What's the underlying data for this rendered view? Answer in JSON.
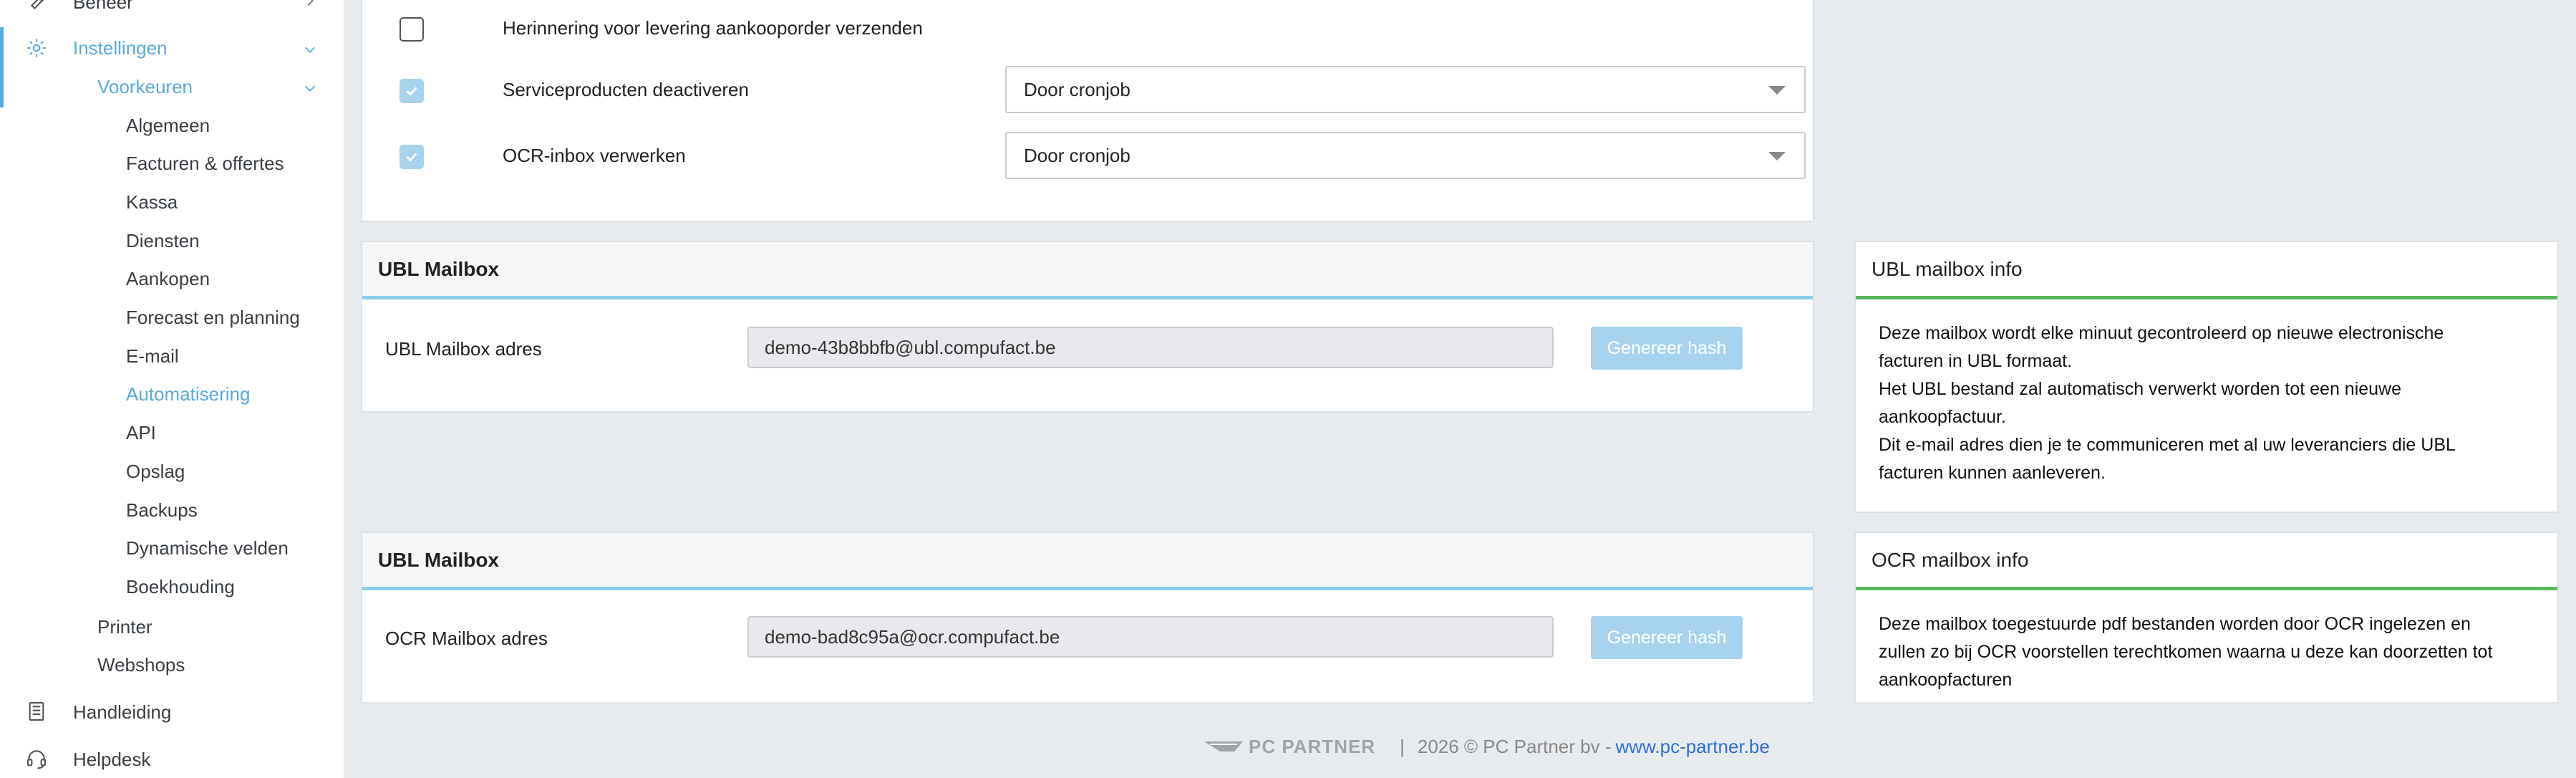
{
  "sidebar": {
    "beheer": "Beheer",
    "instellingen": "Instellingen",
    "voorkeuren": "Voorkeuren",
    "sub_items": [
      {
        "label": "Algemeen",
        "active": false
      },
      {
        "label": "Facturen & offertes",
        "active": false
      },
      {
        "label": "Kassa",
        "active": false
      },
      {
        "label": "Diensten",
        "active": false
      },
      {
        "label": "Aankopen",
        "active": false
      },
      {
        "label": "Forecast en planning",
        "active": false
      },
      {
        "label": "E-mail",
        "active": false
      },
      {
        "label": "Automatisering",
        "active": true
      },
      {
        "label": "API",
        "active": false
      },
      {
        "label": "Opslag",
        "active": false
      },
      {
        "label": "Backups",
        "active": false
      },
      {
        "label": "Dynamische velden",
        "active": false
      },
      {
        "label": "Boekhouding",
        "active": false
      }
    ],
    "printer": "Printer",
    "webshops": "Webshops",
    "handleiding": "Handleiding",
    "helpdesk": "Helpdesk"
  },
  "automation": {
    "rows": [
      {
        "label": "Herinnering voor levering aankooporder verzenden",
        "checked": false
      },
      {
        "label": "Serviceproducten deactiveren",
        "checked": true,
        "select": "Door cronjob"
      },
      {
        "label": "OCR-inbox verwerken",
        "checked": true,
        "select": "Door cronjob"
      }
    ]
  },
  "ubl": {
    "title": "UBL Mailbox",
    "label": "UBL Mailbox adres",
    "value": "demo-43b8bbfb@ubl.compufact.be",
    "button": "Genereer hash"
  },
  "ubl_info": {
    "title": "UBL mailbox info",
    "lines": [
      "Deze mailbox wordt elke minuut gecontroleerd op nieuwe electronische",
      "facturen in UBL formaat.",
      "Het UBL bestand zal automatisch verwerkt worden tot een nieuwe",
      "aankoopfactuur.",
      "Dit e-mail adres dien je te communiceren met al uw leveranciers die UBL",
      "facturen kunnen aanleveren."
    ]
  },
  "ocr": {
    "title": "UBL Mailbox",
    "label": "OCR Mailbox adres",
    "value": "demo-bad8c95a@ocr.compufact.be",
    "button": "Genereer hash"
  },
  "ocr_info": {
    "title": "OCR mailbox info",
    "lines": [
      "Deze mailbox toegestuurde pdf bestanden worden door OCR ingelezen en",
      "zullen zo bij OCR voorstellen terechtkomen waarna u deze kan doorzetten tot",
      "aankoopfacturen"
    ]
  },
  "footer": {
    "logo": "PC PARTNER",
    "separator": "|",
    "copyright": "2026 © PC Partner bv - ",
    "link": "www.pc-partner.be"
  },
  "colors": {
    "accent": "#5aa9df",
    "button": "#a7d3ee",
    "info_border": "#5cb85c"
  }
}
